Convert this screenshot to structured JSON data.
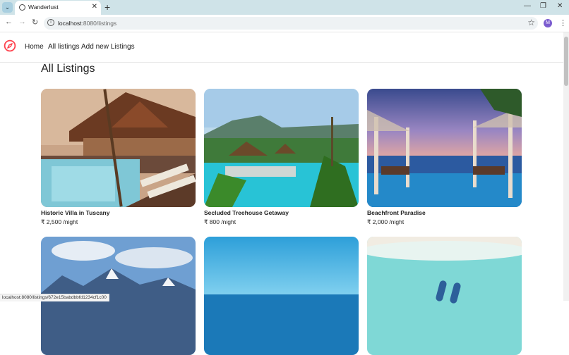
{
  "browser": {
    "tab_title": "Wanderlust",
    "url_host": "localhost",
    "url_path": ":8080/listings",
    "profile_initial": "M",
    "status_url": "localhost:8080/listings/672e15babdbbfd1234cf1c00"
  },
  "nav": {
    "links": [
      "Home",
      "All listings",
      "Add new Listings"
    ],
    "brand_color": "#fe424d"
  },
  "page": {
    "title": "All Listings"
  },
  "listings": [
    {
      "name": "Historic Villa in Tuscany",
      "price": "₹ 2,500 /night"
    },
    {
      "name": "Secluded Treehouse Getaway",
      "price": "₹ 800 /night"
    },
    {
      "name": "Beachfront Paradise",
      "price": "₹ 2,000 /night"
    },
    {
      "name": "",
      "price": ""
    },
    {
      "name": "",
      "price": ""
    },
    {
      "name": "",
      "price": ""
    }
  ]
}
